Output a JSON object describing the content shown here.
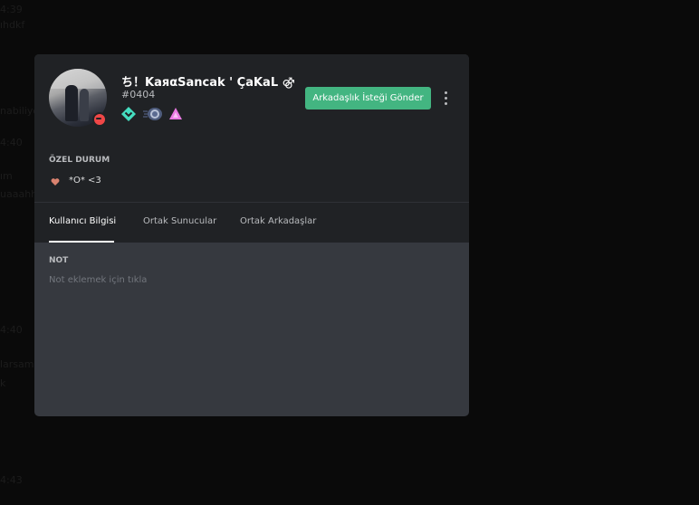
{
  "background": {
    "fragments": [
      "4:39",
      "ıhdkf",
      "nabiliyo",
      "4:40",
      "ım",
      "uaaahh",
      "4:40",
      "larsam",
      "k",
      "4:43"
    ]
  },
  "profile": {
    "username": "ち！KaяαSancak ' ÇaKaL ⚣",
    "discriminator": "#0404",
    "status": "do-not-disturb",
    "badges": [
      "hypesquad-balance-icon",
      "nitro-boost-icon",
      "early-supporter-icon"
    ]
  },
  "actions": {
    "add_friend_label": "Arkadaşlık İsteği Gönder",
    "more_icon": "vertical-dots-icon"
  },
  "custom_status": {
    "title": "ÖZEL DURUM",
    "emoji": "heart-icon",
    "text": "*O* <3"
  },
  "tabs": [
    {
      "label": "Kullanıcı Bilgisi",
      "active": true
    },
    {
      "label": "Ortak Sunucular",
      "active": false
    },
    {
      "label": "Ortak Arkadaşlar",
      "active": false
    }
  ],
  "note": {
    "title": "NOT",
    "placeholder": "Not eklemek için tıkla"
  },
  "colors": {
    "accent_green": "#43b581",
    "dnd_red": "#f04747",
    "header_bg": "#202225",
    "body_bg": "#36393f"
  }
}
